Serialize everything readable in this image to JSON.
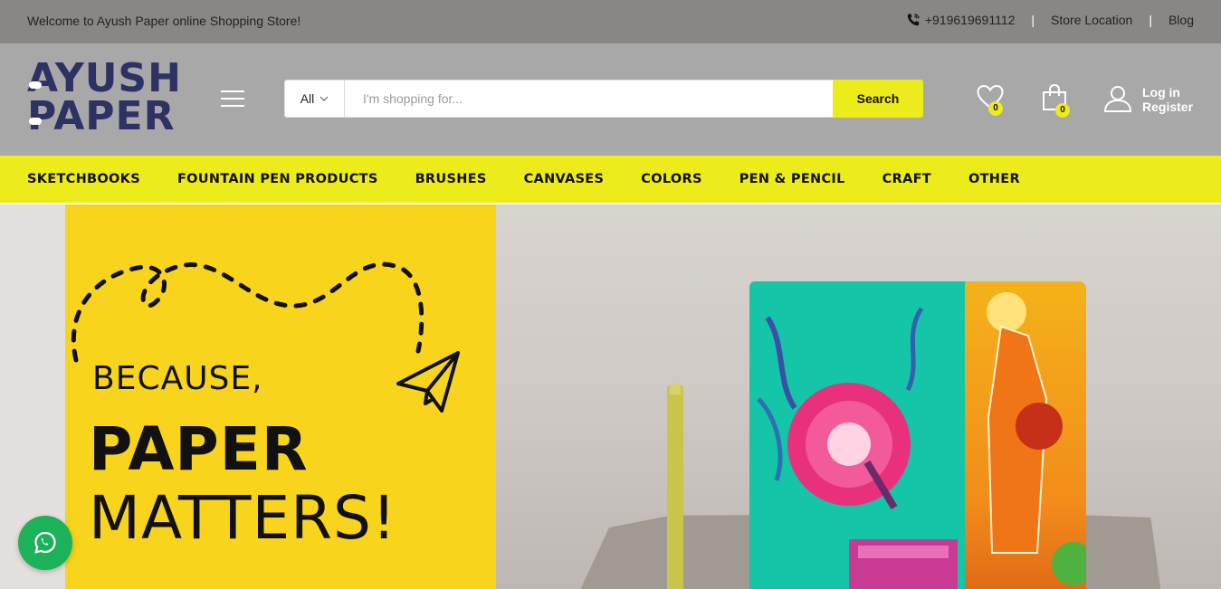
{
  "topbar": {
    "welcome": "Welcome to Ayush Paper online Shopping Store!",
    "phone": "+919619691112",
    "store_location": "Store Location",
    "blog": "Blog",
    "icons": {
      "phone": "phone-icon"
    }
  },
  "header": {
    "logo_line1": "AYUSH",
    "logo_line2": "PAPER",
    "menu_icon": "hamburger-menu-icon",
    "search": {
      "category": "All",
      "placeholder": "I'm shopping for...",
      "button": "Search"
    },
    "wishlist_count": "0",
    "cart_count": "0",
    "login": "Log in",
    "register": "Register",
    "icons": {
      "wishlist": "heart-icon",
      "cart": "shopping-bag-icon",
      "account": "user-icon"
    }
  },
  "nav": {
    "items": [
      "SKETCHBOOKS",
      "FOUNTAIN PEN PRODUCTS",
      "BRUSHES",
      "CANVASES",
      "COLORS",
      "PEN & PENCIL",
      "CRAFT",
      "OTHER"
    ]
  },
  "hero": {
    "line1": "BECAUSE,",
    "line2": "PAPER",
    "line3": "MATTERS!"
  },
  "floating": {
    "whatsapp_icon": "whatsapp-icon"
  },
  "colors": {
    "topbar_bg": "#8a8686",
    "header_bg": "#a8a8a8",
    "accent_yellow": "#ecec1a",
    "logo_navy": "#2c3263",
    "whatsapp_green": "#1bb25a"
  }
}
